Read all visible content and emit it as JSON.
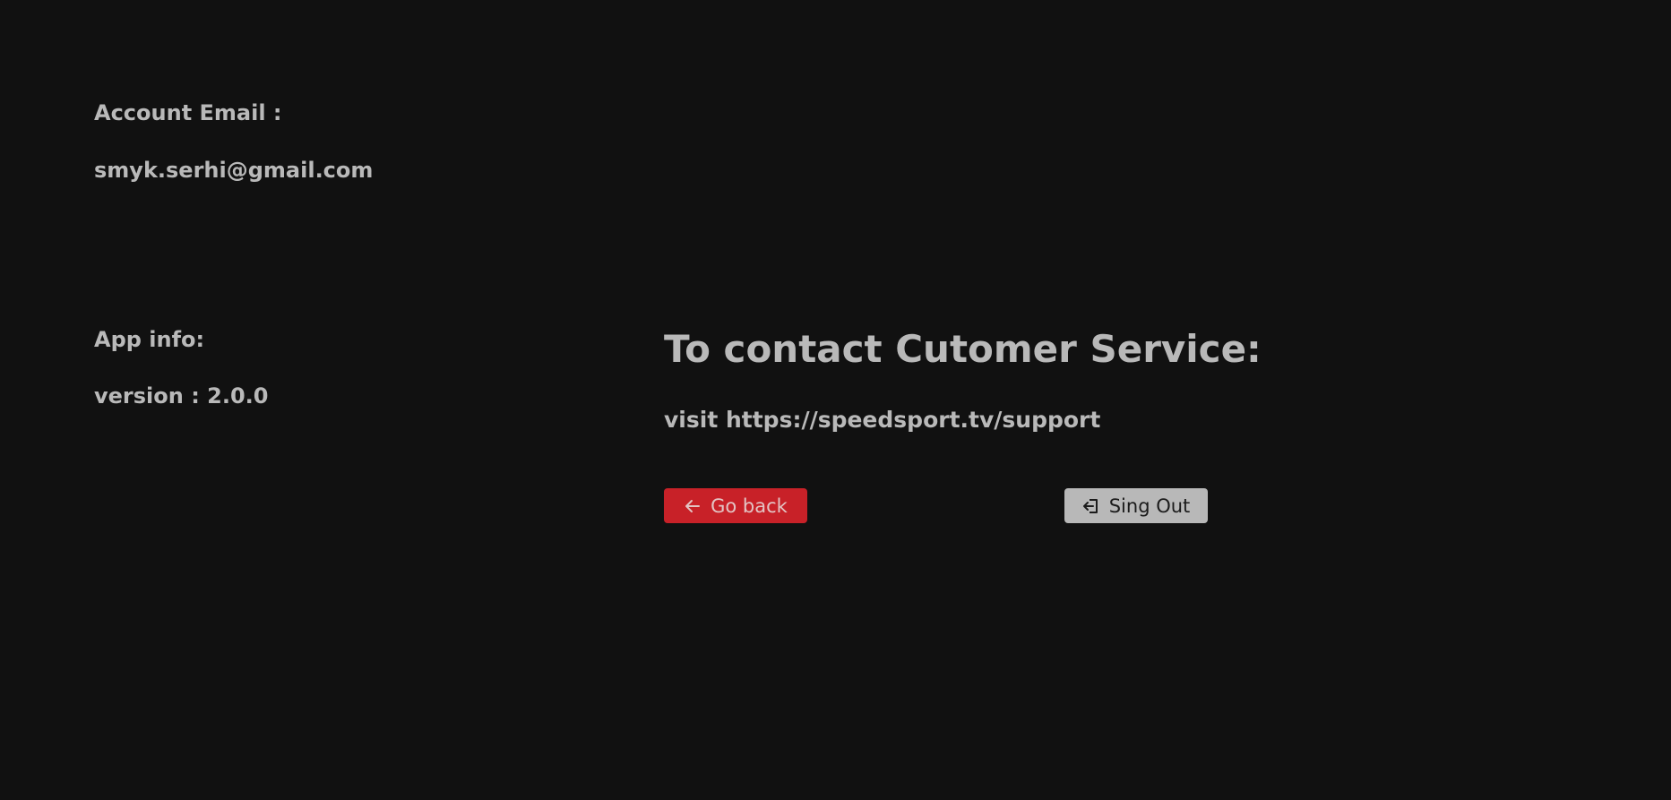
{
  "account": {
    "email_label": "Account Email :",
    "email_value": "smyk.serhi@gmail.com"
  },
  "app_info": {
    "label": "App info:",
    "version_text": "version : 2.0.0"
  },
  "contact": {
    "heading": "To contact Cutomer Service:",
    "visit_text": "visit https://speedsport.tv/support"
  },
  "buttons": {
    "go_back_label": "Go back",
    "go_back_icon": "arrow-left-icon",
    "sign_out_label": "Sing Out",
    "sign_out_icon": "sign-out-icon"
  },
  "colors": {
    "background": "#111111",
    "text": "#b9b9b9",
    "accent_red": "#c82128",
    "button_gray": "#b8b8b8"
  }
}
